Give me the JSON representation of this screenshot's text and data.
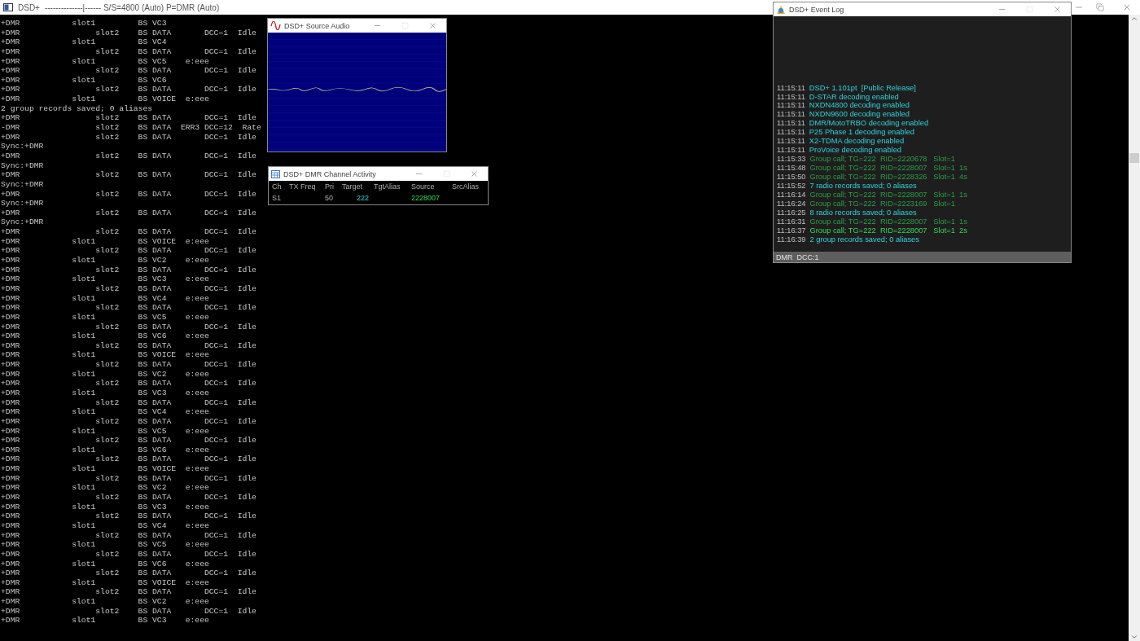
{
  "window": {
    "title": "DSD+",
    "subtitle": "--------------|------ S/S=4800 (Auto) P=DMR (Auto)"
  },
  "console": {
    "lines": [
      "+DMR           slot1         BS VC3",
      "+DMR                slot2    BS DATA       DCC=1  Idle",
      "+DMR           slot1         BS VC4",
      "+DMR                slot2    BS DATA       DCC=1  Idle",
      "+DMR           slot1         BS VC5    e:eee",
      "+DMR                slot2    BS DATA       DCC=1  Idle",
      "+DMR           slot1         BS VC6",
      "+DMR                slot2    BS DATA       DCC=1  Idle",
      "+DMR           slot1         BS VOICE  e:eee",
      "2 group records saved; 0 aliases",
      "+DMR                slot2    BS DATA       DCC=1  Idle",
      "-DMR                slot2    BS DATA  ERR3 DCC=12  Rate",
      "+DMR                slot2    BS DATA       DCC=1  Idle",
      "Sync:+DMR",
      "+DMR                slot2    BS DATA       DCC=1  Idle",
      "Sync:+DMR",
      "+DMR                slot2    BS DATA       DCC=1  Idle",
      "Sync:+DMR",
      "+DMR                slot2    BS DATA       DCC=1  Idle",
      "Sync:+DMR",
      "+DMR                slot2    BS DATA       DCC=1  Idle",
      "Sync:+DMR",
      "+DMR                slot2    BS DATA       DCC=1  Idle",
      "+DMR           slot1         BS VOICE  e:eee",
      "+DMR                slot2    BS DATA       DCC=1  Idle",
      "+DMR           slot1         BS VC2    e:eee",
      "+DMR                slot2    BS DATA       DCC=1  Idle",
      "+DMR           slot1         BS VC3    e:eee",
      "+DMR                slot2    BS DATA       DCC=1  Idle",
      "+DMR           slot1         BS VC4    e:eee",
      "+DMR                slot2    BS DATA       DCC=1  Idle",
      "+DMR           slot1         BS VC5    e:eee",
      "+DMR                slot2    BS DATA       DCC=1  Idle",
      "+DMR           slot1         BS VC6    e:eee",
      "+DMR                slot2    BS DATA       DCC=1  Idle",
      "+DMR           slot1         BS VOICE  e:eee",
      "+DMR                slot2    BS DATA       DCC=1  Idle",
      "+DMR           slot1         BS VC2    e:eee",
      "+DMR                slot2    BS DATA       DCC=1  Idle",
      "+DMR           slot1         BS VC3    e:eee",
      "+DMR                slot2    BS DATA       DCC=1  Idle",
      "+DMR           slot1         BS VC4    e:eee",
      "+DMR                slot2    BS DATA       DCC=1  Idle",
      "+DMR           slot1         BS VC5    e:eee",
      "+DMR                slot2    BS DATA       DCC=1  Idle",
      "+DMR           slot1         BS VC6    e:eee",
      "+DMR                slot2    BS DATA       DCC=1  Idle",
      "+DMR           slot1         BS VOICE  e:eee",
      "+DMR                slot2    BS DATA       DCC=1  Idle",
      "+DMR           slot1         BS VC2    e:eee",
      "+DMR                slot2    BS DATA       DCC=1  Idle",
      "+DMR           slot1         BS VC3    e:eee",
      "+DMR                slot2    BS DATA       DCC=1  Idle",
      "+DMR           slot1         BS VC4    e:eee",
      "+DMR                slot2    BS DATA       DCC=1  Idle",
      "+DMR           slot1         BS VC5    e:eee",
      "+DMR                slot2    BS DATA       DCC=1  Idle",
      "+DMR           slot1         BS VC6    e:eee",
      "+DMR                slot2    BS DATA       DCC=1  Idle",
      "+DMR           slot1         BS VOICE  e:eee",
      "+DMR                slot2    BS DATA       DCC=1  Idle",
      "+DMR           slot1         BS VC2    e:eee",
      "+DMR                slot2    BS DATA       DCC=1  Idle",
      "+DMR           slot1         BS VC3    e:eee"
    ]
  },
  "source_audio": {
    "title": "DSD+ Source Audio"
  },
  "channel_activity": {
    "title": "DSD+ DMR Channel Activity",
    "columns": [
      "Ch",
      "TX Freq",
      "Pri",
      "Target",
      "TgtAlias",
      "Source",
      "SrcAlias"
    ],
    "rows": [
      {
        "ch": "S1",
        "pri": "50",
        "target": "222",
        "source": "2228007"
      }
    ]
  },
  "event_log": {
    "title": "DSD+ Event Log",
    "events": [
      {
        "time": "11:15:11",
        "text": "DSD+ 1.101pt  [Public Release]",
        "kind": "info"
      },
      {
        "time": "11:15:11",
        "text": "D-STAR decoding enabled",
        "kind": "info"
      },
      {
        "time": "11:15:11",
        "text": "NXDN4800 decoding enabled",
        "kind": "info"
      },
      {
        "time": "11:15:11",
        "text": "NXDN9600 decoding enabled",
        "kind": "info"
      },
      {
        "time": "11:15:11",
        "text": "DMR/MotoTRBO decoding enabled",
        "kind": "info"
      },
      {
        "time": "11:15:11",
        "text": "P25 Phase 1 decoding enabled",
        "kind": "info"
      },
      {
        "time": "11:15:11",
        "text": "X2-TDMA decoding enabled",
        "kind": "info"
      },
      {
        "time": "11:15:11",
        "text": "ProVoice decoding enabled",
        "kind": "info"
      },
      {
        "time": "11:15:33",
        "text": "Group call; TG=222  RID=2220678   Slot=1",
        "kind": "call"
      },
      {
        "time": "11:15:48",
        "text": "Group call; TG=222  RID=2228007   Slot=1  1s",
        "kind": "call"
      },
      {
        "time": "11:15:50",
        "text": "Group call; TG=222  RID=2228326   Slot=1  4s",
        "kind": "call"
      },
      {
        "time": "11:15:52",
        "text": "7 radio records saved; 0 aliases",
        "kind": "info"
      },
      {
        "time": "11:16:14",
        "text": "Group call; TG=222  RID=2228007   Slot=1  1s",
        "kind": "call"
      },
      {
        "time": "11:16:24",
        "text": "Group call; TG=222  RID=2223169   Slot=1",
        "kind": "call"
      },
      {
        "time": "11:16:25",
        "text": "8 radio records saved; 0 aliases",
        "kind": "info"
      },
      {
        "time": "11:16:31",
        "text": "Group call; TG=222  RID=2228007   Slot=1  1s",
        "kind": "call"
      },
      {
        "time": "11:16:37",
        "text": "Group call; TG=222  RID=2228007   Slot=1  2s",
        "kind": "active_call"
      },
      {
        "time": "11:16:39",
        "text": "2 group records saved; 0 aliases",
        "kind": "info"
      }
    ],
    "status": "DMR  DCC:1"
  }
}
